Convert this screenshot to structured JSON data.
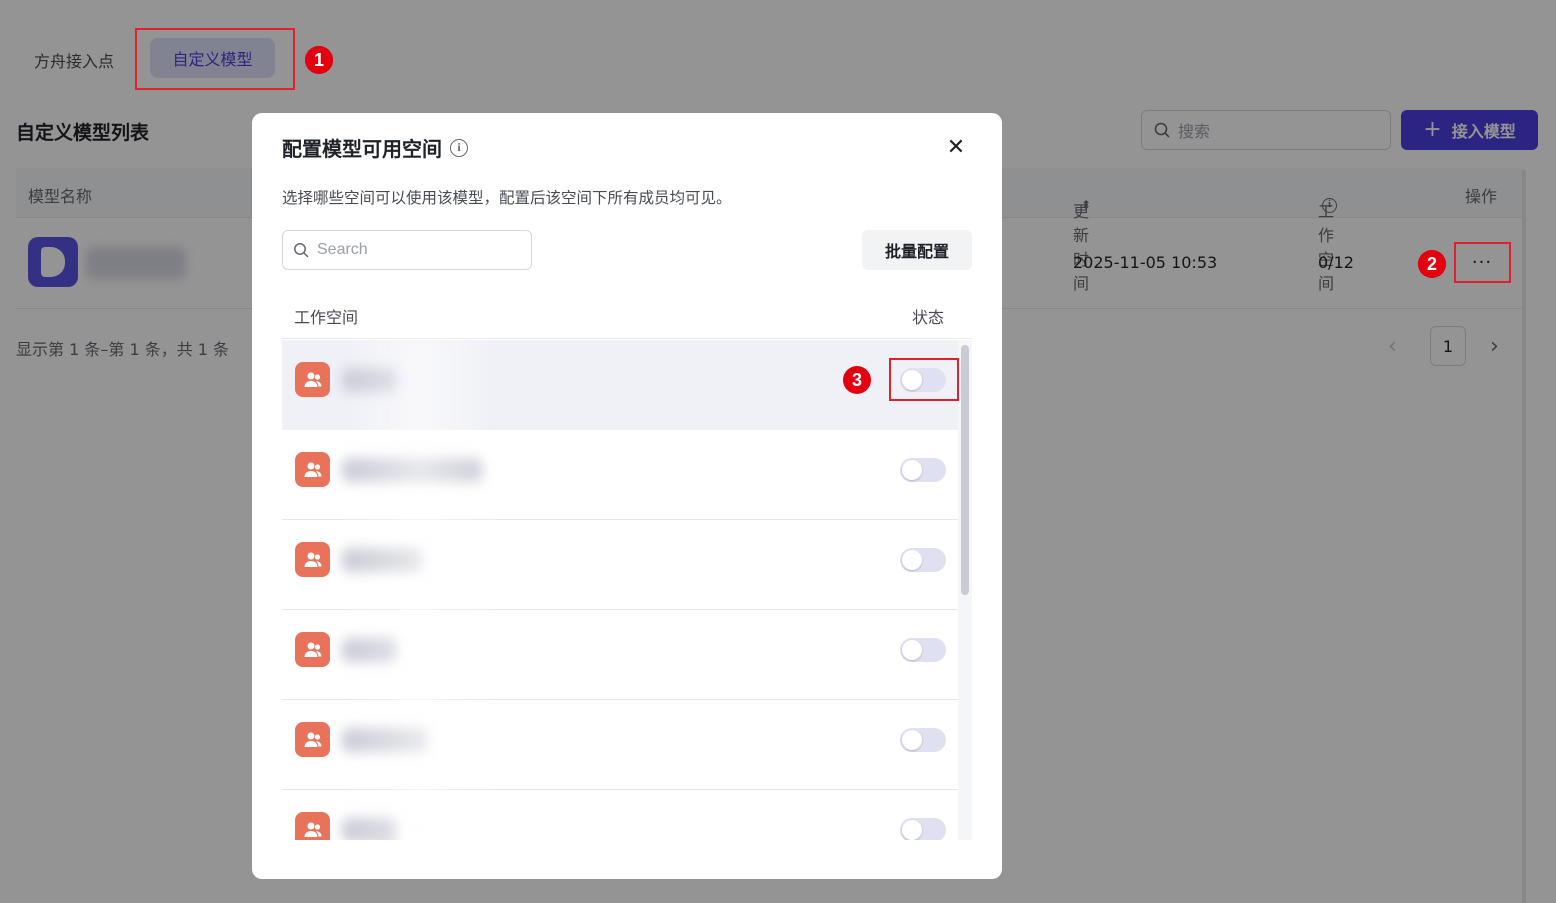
{
  "tabs": [
    {
      "label": "方舟接入点",
      "active": false
    },
    {
      "label": "自定义模型",
      "active": true
    }
  ],
  "callouts": {
    "one": "1",
    "two": "2",
    "three": "3"
  },
  "list": {
    "title": "自定义模型列表",
    "search_placeholder": "搜索",
    "add_button": "接入模型",
    "columns": [
      "模型名称",
      "更新时间",
      "工作空间",
      "操作"
    ],
    "rows": [
      {
        "updated": "2025-11-05 10:53",
        "workspaces": "0/12",
        "more": "···"
      }
    ],
    "pagination_text": "显示第 1 条–第 1 条，共 1 条",
    "current_page": "1"
  },
  "modal": {
    "title": "配置模型可用空间",
    "close_label": "✕",
    "description": "选择哪些空间可以使用该模型，配置后该空间下所有成员均可见。",
    "search_placeholder": "Search",
    "batch_button": "批量配置",
    "col_workspace": "工作空间",
    "col_status": "状态",
    "workspaces": [
      {
        "enabled": false,
        "selected": true
      },
      {
        "enabled": false,
        "selected": false
      },
      {
        "enabled": false,
        "selected": false
      },
      {
        "enabled": false,
        "selected": false
      },
      {
        "enabled": false,
        "selected": false
      },
      {
        "enabled": false,
        "selected": false
      }
    ]
  },
  "colors": {
    "accent": "#4b3fe0",
    "tab_active_bg": "#dfe0fb",
    "callout_red": "#e3000f",
    "workspace_avatar": "#e8735a",
    "toggle_off": "#dfe1f2"
  },
  "icons": {
    "search": "search-icon",
    "info": "info-icon",
    "close": "close-icon",
    "sort": "sort-icon",
    "plus": "plus-icon",
    "more": "more-icon",
    "workspace": "team-icon",
    "prev": "chevron-left-icon",
    "next": "chevron-right-icon"
  }
}
